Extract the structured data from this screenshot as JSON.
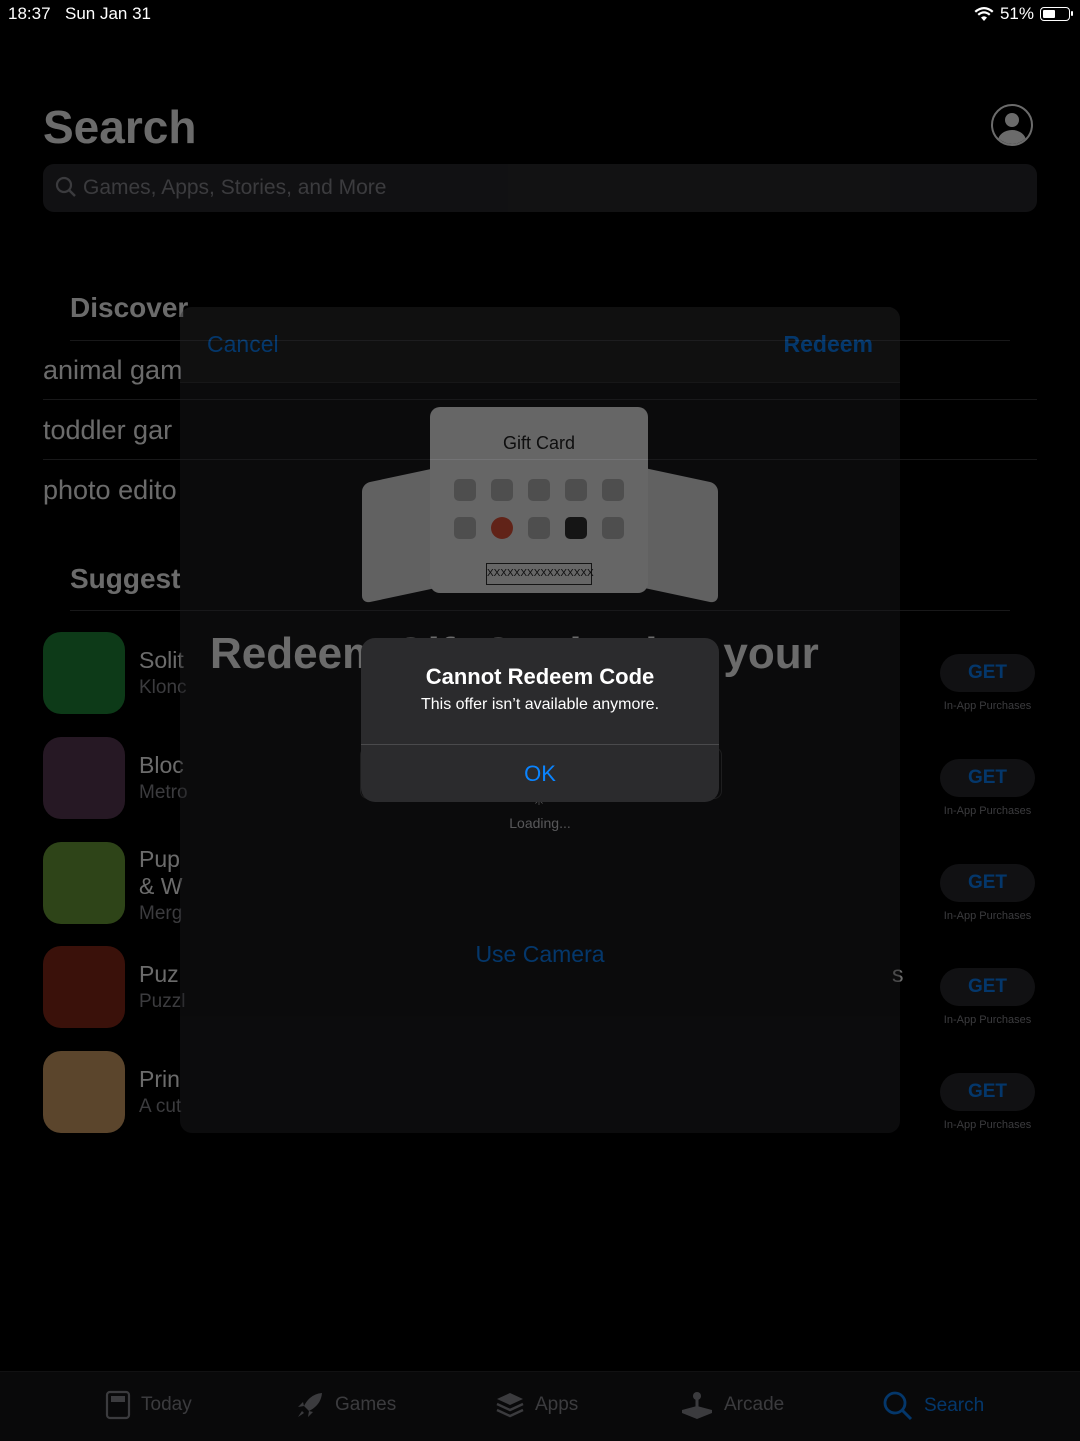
{
  "status": {
    "time": "18:37",
    "date": "Sun Jan 31",
    "battery": "51%"
  },
  "page": {
    "title": "Search",
    "search_placeholder": "Games, Apps, Stories, and More"
  },
  "discover": {
    "title": "Discover",
    "items": [
      "animal gam",
      "toddler gar",
      "photo edito"
    ]
  },
  "suggested": {
    "title": "Suggest",
    "apps": [
      {
        "name": "Solit",
        "subtitle": "Klonc",
        "button": "GET",
        "note": "In-App Purchases",
        "icon_color": "#1f8a3a"
      },
      {
        "name": "Bloc",
        "subtitle": "Metro",
        "button": "GET",
        "note": "In-App Purchases",
        "icon_color": "#5b3a56"
      },
      {
        "name": "Pup",
        "name2": "& W",
        "subtitle": "Merg",
        "button": "GET",
        "note": "In-App Purchases",
        "icon_color": "#6ea23a"
      },
      {
        "name": "Puz",
        "subtitle": "Puzzl",
        "button": "GET",
        "note": "In-App Purchases",
        "icon_color": "#8a2a1a",
        "right_text": "s"
      },
      {
        "name": "Prin",
        "subtitle": "A cut",
        "button": "GET",
        "note": "In-App Purchases",
        "icon_color": "#d9a56a"
      }
    ]
  },
  "sheet": {
    "cancel": "Cancel",
    "redeem": "Redeem",
    "gift_card_title": "Gift Card",
    "gift_card_code": "XXXXXXXXXXXXXXXX",
    "heading": "Redeem Gift Card using your",
    "loading": "Loading...",
    "use_camera": "Use Camera",
    "info": "",
    "info2": ""
  },
  "alert": {
    "title": "Cannot Redeem Code",
    "message": "This offer isn’t available anymore.",
    "ok": "OK"
  },
  "tabs": [
    {
      "label": "Today",
      "icon": "today-icon"
    },
    {
      "label": "Games",
      "icon": "rocket-icon"
    },
    {
      "label": "Apps",
      "icon": "apps-stack-icon"
    },
    {
      "label": "Arcade",
      "icon": "joystick-icon"
    },
    {
      "label": "Search",
      "icon": "search-icon"
    }
  ],
  "colors": {
    "accent": "#0a84ff",
    "background": "#000000",
    "dialog": "#2b2b2d"
  }
}
